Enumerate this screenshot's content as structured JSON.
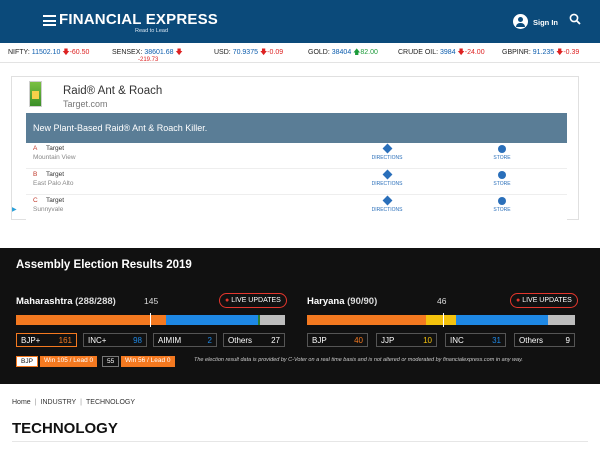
{
  "header": {
    "logo": "FINANCIAL EXPRESS",
    "tagline": "Read to Lead",
    "signin_label": "Sign In"
  },
  "ticker": [
    {
      "label": "NIFTY:",
      "value": "11502.10",
      "change": "-60.50",
      "dir": "down"
    },
    {
      "label": "SENSEX:",
      "value": "38601.68",
      "change": "-219.73",
      "dir": "down"
    },
    {
      "label": "USD:",
      "value": "70.9375",
      "change": "-0.09",
      "dir": "down"
    },
    {
      "label": "GOLD:",
      "value": "38404",
      "change": "82.00",
      "dir": "up"
    },
    {
      "label": "CRUDE OIL:",
      "value": "3984",
      "change": "-24.00",
      "dir": "down"
    },
    {
      "label": "GBPINR:",
      "value": "91.235",
      "change": "-0.39",
      "dir": "down"
    }
  ],
  "ad": {
    "title": "Raid® Ant & Roach",
    "domain": "Target.com",
    "banner": "New Plant-Based Raid® Ant & Roach Killer.",
    "rows": [
      {
        "letter": "A",
        "name": "Target",
        "place": "Mountain View",
        "directions": "DIRECTIONS",
        "store": "STORE"
      },
      {
        "letter": "B",
        "name": "Target",
        "place": "East Palo Alto",
        "directions": "DIRECTIONS",
        "store": "STORE"
      },
      {
        "letter": "C",
        "name": "Target",
        "place": "Sunnyvale",
        "directions": "DIRECTIONS",
        "store": "STORE"
      }
    ]
  },
  "election": {
    "title": "Assembly Election Results 2019",
    "live_label": "LIVE UPDATES",
    "states": [
      {
        "name": "Maharashtra",
        "count": "(288/288)",
        "majority": "145",
        "segments": [
          {
            "party": "BJP+",
            "seats": 161,
            "color": "#f47920"
          },
          {
            "party": "INC+",
            "seats": 98,
            "color": "#1e88e5"
          },
          {
            "party": "AIMIM",
            "seats": 2,
            "color": "#2e7d32"
          },
          {
            "party": "Others",
            "seats": 27,
            "color": "#bdbdbd"
          }
        ]
      },
      {
        "name": "Haryana",
        "count": "(90/90)",
        "majority": "46",
        "segments": [
          {
            "party": "BJP",
            "seats": 40,
            "color": "#f47920"
          },
          {
            "party": "JJP",
            "seats": 10,
            "color": "#f4c20d"
          },
          {
            "party": "INC",
            "seats": 31,
            "color": "#1e88e5"
          },
          {
            "party": "Others",
            "seats": 9,
            "color": "#bdbdbd"
          }
        ]
      }
    ],
    "lead_row": {
      "party": "BJP",
      "bjp_status": "Win 105 / Lead 0",
      "inc_seats": "55",
      "inc_status": "Win 56 / Lead 0"
    },
    "disclaimer": "The election result data is provided by C-Voter on a real time basis and is not altered or moderated by financialexpress.com in any way."
  },
  "breadcrumb": [
    "Home",
    "INDUSTRY",
    "TECHNOLOGY"
  ],
  "page_title": "TECHNOLOGY"
}
